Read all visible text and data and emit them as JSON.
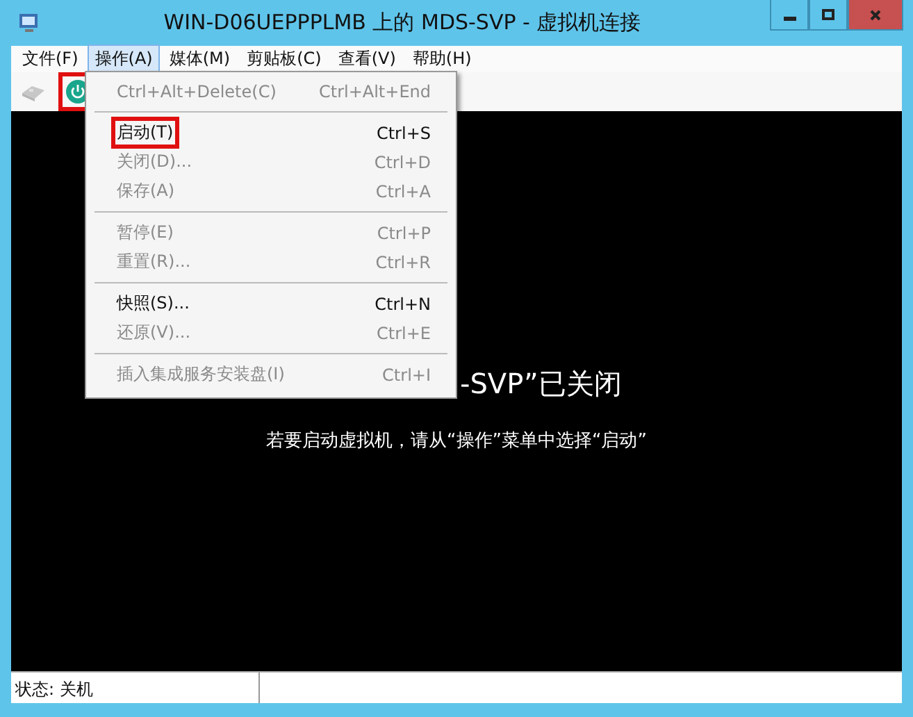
{
  "window": {
    "title": "WIN-D06UEPPPLMB 上的 MDS-SVP - 虚拟机连接",
    "controls": [
      {
        "kind": "minimize"
      },
      {
        "kind": "maximize"
      },
      {
        "kind": "close"
      }
    ]
  },
  "menu_bar": [
    {
      "label": "文件(F)",
      "selected": false
    },
    {
      "label": "操作(A)",
      "selected": true
    },
    {
      "label": "媒体(M)",
      "selected": false
    },
    {
      "label": "剪贴板(C)",
      "selected": false
    },
    {
      "label": "查看(V)",
      "selected": false
    },
    {
      "label": "帮助(H)",
      "selected": false
    }
  ],
  "toolbar": [
    {
      "kind": "ctrl-alt-del",
      "disabled": true,
      "highlighted": false
    },
    {
      "kind": "power",
      "disabled": false,
      "highlighted": true
    }
  ],
  "dropdown": {
    "groups": [
      [
        {
          "label": "Ctrl+Alt+Delete(C)",
          "shortcut": "Ctrl+Alt+End",
          "disabled": true,
          "highlighted": false
        }
      ],
      [
        {
          "label": "启动(T)",
          "shortcut": "Ctrl+S",
          "disabled": false,
          "highlighted": true
        },
        {
          "label": "关闭(D)...",
          "shortcut": "Ctrl+D",
          "disabled": true,
          "highlighted": false
        },
        {
          "label": "保存(A)",
          "shortcut": "Ctrl+A",
          "disabled": true,
          "highlighted": false
        }
      ],
      [
        {
          "label": "暂停(E)",
          "shortcut": "Ctrl+P",
          "disabled": true,
          "highlighted": false
        },
        {
          "label": "重置(R)...",
          "shortcut": "Ctrl+R",
          "disabled": true,
          "highlighted": false
        }
      ],
      [
        {
          "label": "快照(S)...",
          "shortcut": "Ctrl+N",
          "disabled": false,
          "highlighted": false
        },
        {
          "label": "还原(V)...",
          "shortcut": "Ctrl+E",
          "disabled": true,
          "highlighted": false
        }
      ],
      [
        {
          "label": "插入集成服务安装盘(I)",
          "shortcut": "Ctrl+I",
          "disabled": true,
          "highlighted": false
        }
      ]
    ]
  },
  "screen": {
    "heading": "-SVP”已关闭",
    "message": "若要启动虚拟机，请从“操作”菜单中选择“启动”"
  },
  "status_bar": {
    "status": "状态: 关机"
  }
}
